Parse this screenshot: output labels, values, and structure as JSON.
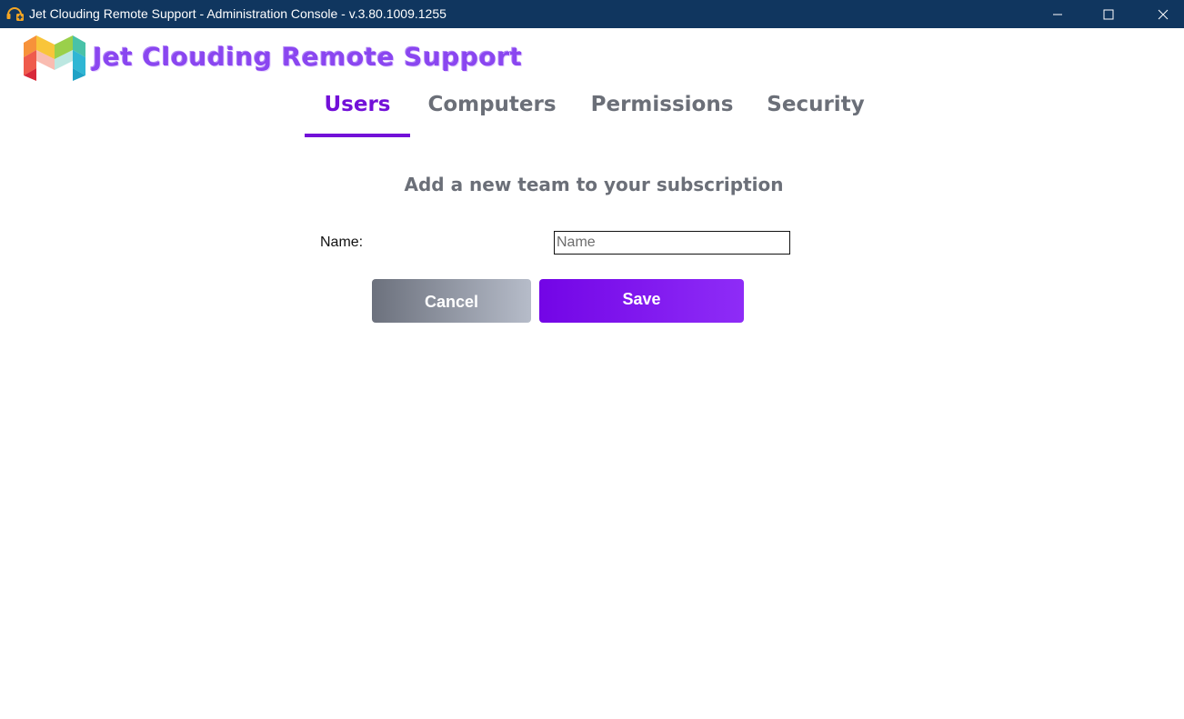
{
  "window": {
    "title": "Jet Clouding Remote Support - Administration Console - v.3.80.1009.1255",
    "controls": [
      "minimize",
      "maximize",
      "close"
    ]
  },
  "logo": {
    "text": "Jet Clouding Remote Support"
  },
  "tabs": [
    {
      "label": "Users",
      "active": true
    },
    {
      "label": "Computers",
      "active": false
    },
    {
      "label": "Permissions",
      "active": false
    },
    {
      "label": "Security",
      "active": false
    }
  ],
  "form": {
    "heading": "Add a new team to your subscription",
    "name_label": "Name:",
    "name_value": "",
    "name_placeholder": "Name",
    "cancel_label": "Cancel",
    "save_label": "Save"
  },
  "colors": {
    "titlebar": "#10365f",
    "accent": "#7210d8",
    "tab_inactive": "#6b6f78",
    "save_button": "#7305e6",
    "cancel_button": "#8c919c"
  },
  "icons": {
    "app": "headset-plus-icon",
    "minimize": "minimize-icon",
    "maximize": "maximize-icon",
    "close": "close-icon"
  }
}
